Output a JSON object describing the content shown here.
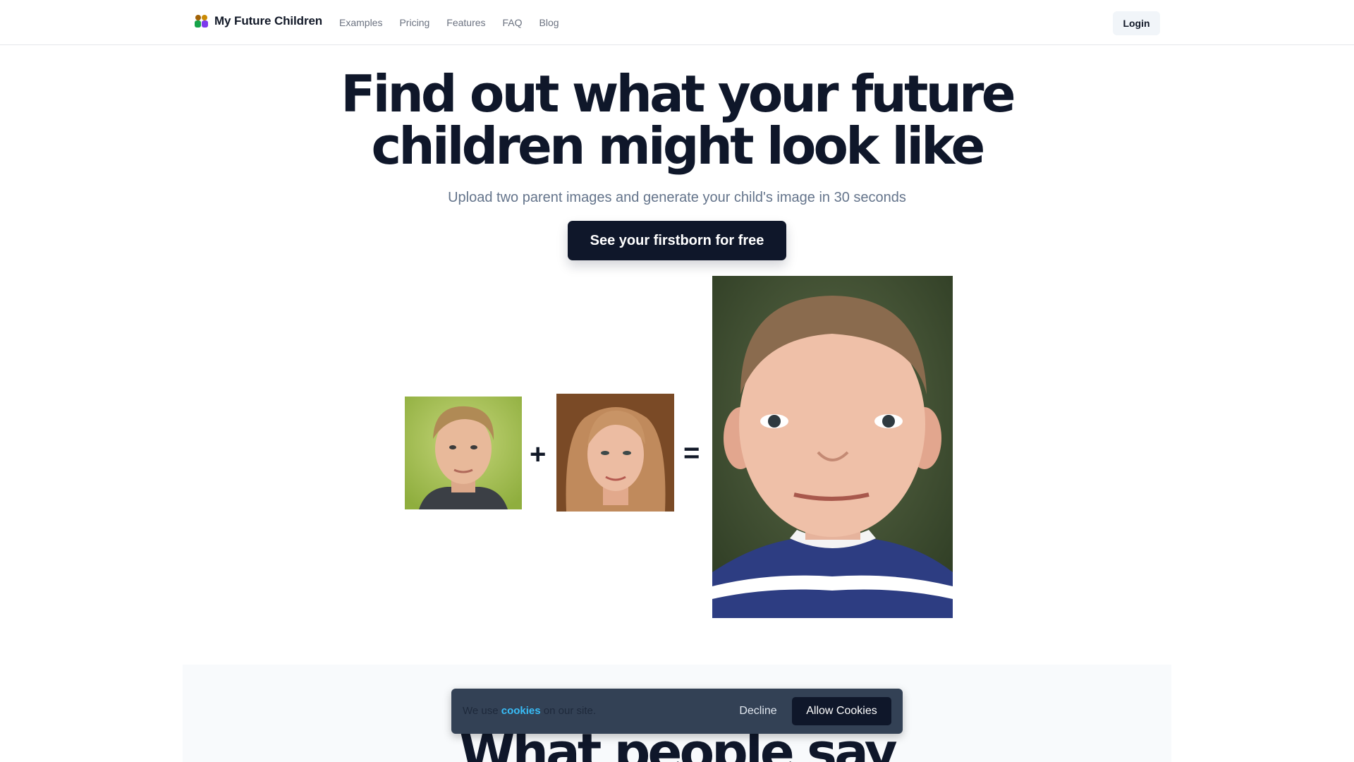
{
  "header": {
    "brand_name": "My Future Children",
    "nav": [
      {
        "label": "Examples"
      },
      {
        "label": "Pricing"
      },
      {
        "label": "Features"
      },
      {
        "label": "FAQ"
      },
      {
        "label": "Blog"
      }
    ],
    "login_label": "Login"
  },
  "hero": {
    "title_line1": "Find out what your future",
    "title_line2": "children might look like",
    "subtitle": "Upload two parent images and generate your child's image in 30 seconds",
    "cta_label": "See your firstborn for free",
    "plus": "+",
    "equals": "="
  },
  "testimonials": {
    "title": "What people say"
  },
  "cookie_banner": {
    "text_before": "We use ",
    "link": "cookies",
    "text_after": " on our site.",
    "decline_label": "Decline",
    "allow_label": "Allow Cookies"
  },
  "colors": {
    "primary": "#0f172a",
    "link": "#38bdf8",
    "banner": "#334155"
  }
}
